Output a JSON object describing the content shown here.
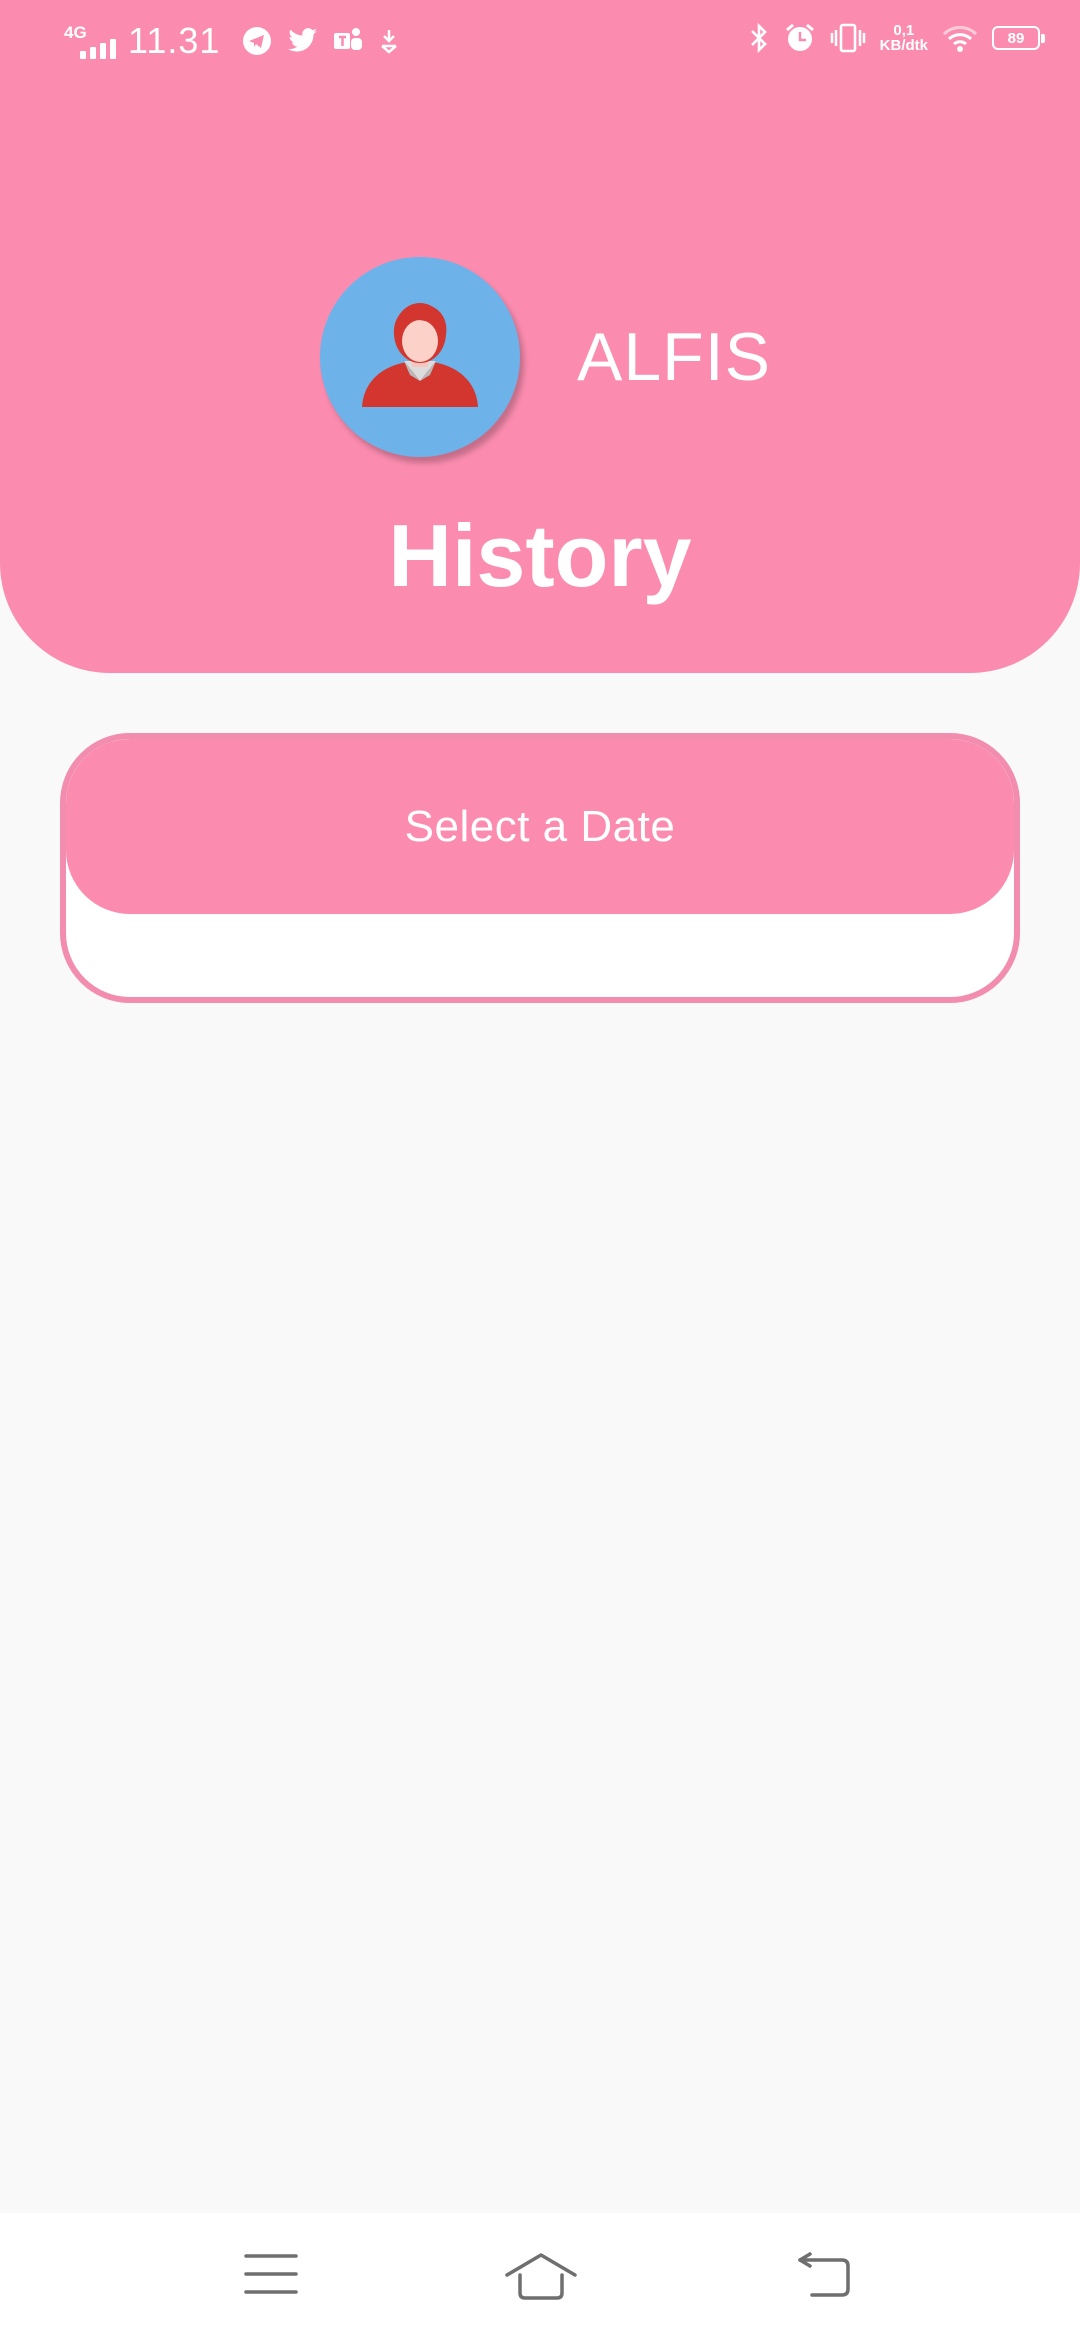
{
  "status_bar": {
    "network": "4G",
    "time": "11.31",
    "speed_value": "0,1",
    "speed_unit": "KB/dtk",
    "battery": "89"
  },
  "header": {
    "username": "ALFIS",
    "title": "History"
  },
  "date_card": {
    "select_label": "Select a Date"
  },
  "icons": {
    "status_left": [
      "telegram-icon",
      "twitter-icon",
      "teams-icon",
      "download-icon"
    ],
    "status_right": [
      "bluetooth-icon",
      "alarm-icon",
      "vibrate-icon",
      "wifi-icon",
      "battery-icon"
    ],
    "nav": [
      "menu-icon",
      "home-icon",
      "back-icon"
    ]
  },
  "colors": {
    "primary": "#fb8caf",
    "background": "#f9f9f9",
    "avatar_bg": "#6db3ea"
  }
}
